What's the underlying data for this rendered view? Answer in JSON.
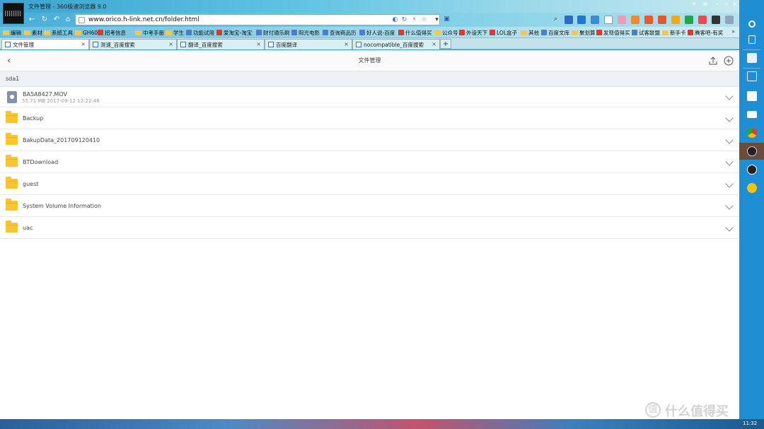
{
  "browser": {
    "window_title": "文件管理 - 360极速浏览器 9.0",
    "url": "www.orico.h-link.net.cn/folder.html"
  },
  "bookmarks": [
    {
      "label": "编辑",
      "icon": "folder"
    },
    {
      "label": "素材",
      "icon": "folder"
    },
    {
      "label": "系统工具",
      "icon": "folder"
    },
    {
      "label": "GH60",
      "icon": "folder"
    },
    {
      "label": "招考信息",
      "icon": "red"
    },
    {
      "label": "中考手册",
      "icon": "folder"
    },
    {
      "label": "学生",
      "icon": "folder"
    },
    {
      "label": "功能试用",
      "icon": "page"
    },
    {
      "label": "爱淘宝-淘宝",
      "icon": "red"
    },
    {
      "label": "财付通乐刷",
      "icon": "page"
    },
    {
      "label": "阳光电影",
      "icon": "page"
    },
    {
      "label": "查询商品历",
      "icon": "page"
    },
    {
      "label": "好人说-百度",
      "icon": "page"
    },
    {
      "label": "什么值得买",
      "icon": "red"
    },
    {
      "label": "公众号",
      "icon": "folder"
    },
    {
      "label": "外设天下",
      "icon": "red"
    },
    {
      "label": "LOL盒子",
      "icon": "red"
    },
    {
      "label": "其他",
      "icon": "folder"
    },
    {
      "label": "百度文库",
      "icon": "page"
    },
    {
      "label": "聚划算",
      "icon": "folder"
    },
    {
      "label": "发现值得买",
      "icon": "red"
    },
    {
      "label": "试客联盟",
      "icon": "page"
    },
    {
      "label": "新手卡",
      "icon": "folder"
    },
    {
      "label": "腾客吧-有奖",
      "icon": "red"
    }
  ],
  "tabs": [
    {
      "label": "文件管理",
      "active": true
    },
    {
      "label": "测速_百度搜索",
      "active": false
    },
    {
      "label": "翻译_百度搜索",
      "active": false
    },
    {
      "label": "百度翻译",
      "active": false
    },
    {
      "label": "nocompatible_百度搜索",
      "active": false
    }
  ],
  "page": {
    "title": "文件管理",
    "section": "sda1",
    "items": [
      {
        "name": "BA5A8427.MOV",
        "type": "video",
        "meta": "55.71 MB   2017-09-12 12:22:46"
      },
      {
        "name": "Backup",
        "type": "folder"
      },
      {
        "name": "BakupData_201709120410",
        "type": "folder"
      },
      {
        "name": "BTDownload",
        "type": "folder"
      },
      {
        "name": "guest",
        "type": "folder"
      },
      {
        "name": "System Volume Information",
        "type": "folder"
      },
      {
        "name": "uac",
        "type": "folder"
      }
    ]
  },
  "taskbar": {
    "time": "11:32"
  },
  "watermark": {
    "text": "什么值得买",
    "logo": "值"
  }
}
